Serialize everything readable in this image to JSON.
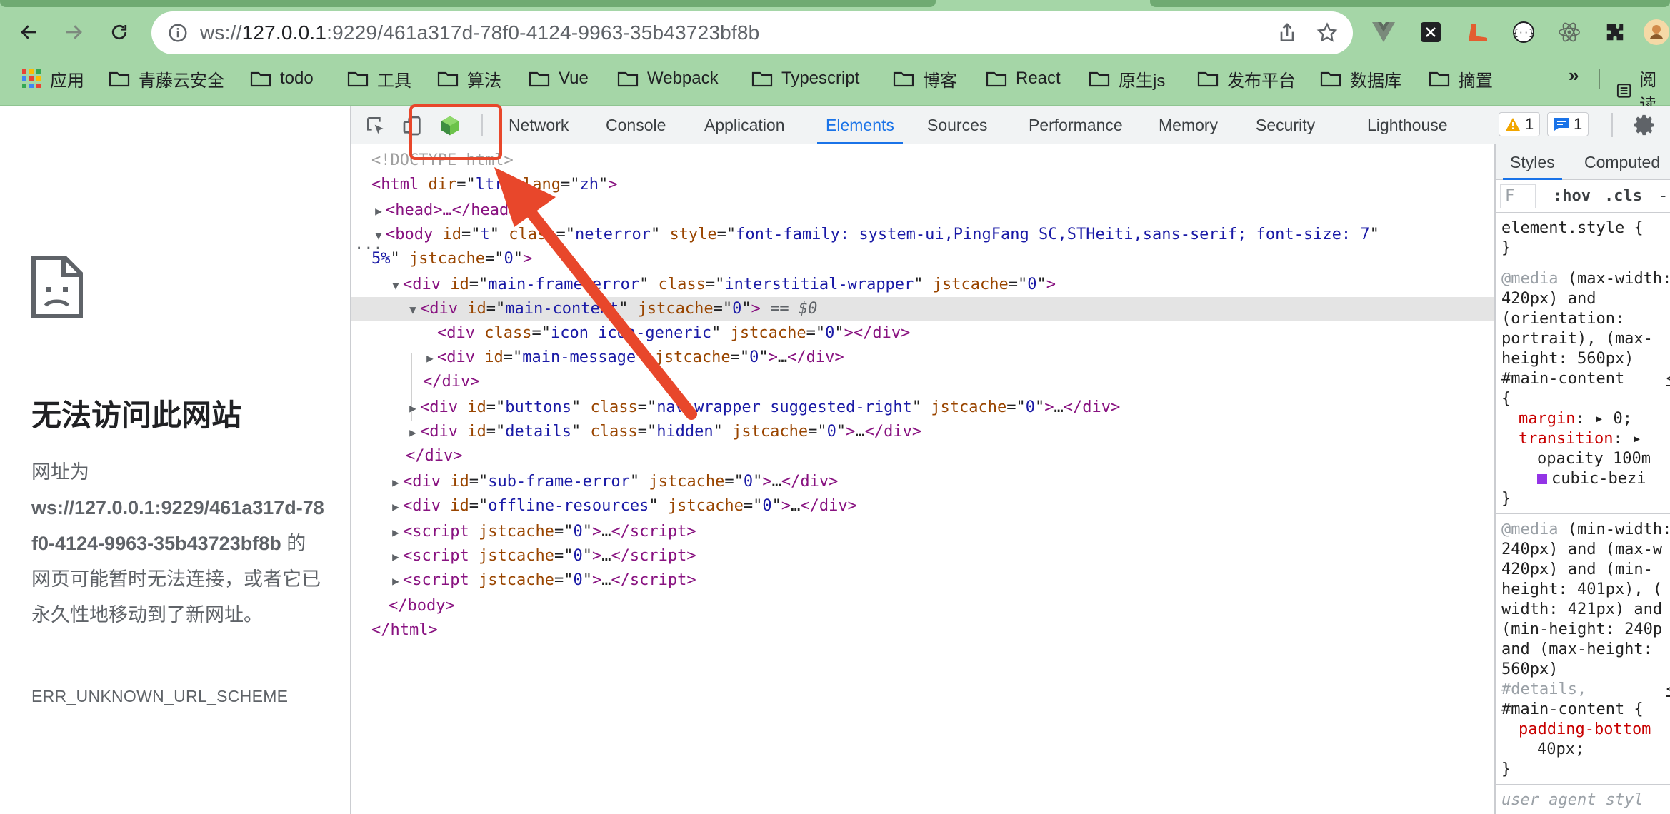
{
  "browser": {
    "url_scheme_host": "ws://",
    "url_host": "127.0.0.1",
    "url_rest": ":9229/461a317d-78f0-4124-9963-35b43723bf8b",
    "bookmarks": [
      {
        "label": "应用",
        "icon": "apps-grid-icon"
      },
      {
        "label": "青藤云安全"
      },
      {
        "label": "todo"
      },
      {
        "label": "工具"
      },
      {
        "label": "算法"
      },
      {
        "label": "Vue"
      },
      {
        "label": "Webpack"
      },
      {
        "label": "Typescript"
      },
      {
        "label": "博客"
      },
      {
        "label": "React"
      },
      {
        "label": "原生js"
      },
      {
        "label": "发布平台"
      },
      {
        "label": "数据库"
      },
      {
        "label": "摘置"
      }
    ],
    "bookmarks_more": "»",
    "reading_list": "阅读"
  },
  "error_page": {
    "title": "无法访问此网站",
    "body_prefix": "网址为",
    "body_url": "ws://127.0.0.1:9229/461a317d-78f0-4124-9963-35b43723bf8b",
    "body_suffix": " 的网页可能暂时无法连接，或者它已永久性地移动到了新网址。",
    "error_code": "ERR_UNKNOWN_URL_SCHEME"
  },
  "devtools": {
    "tabs": [
      "Network",
      "Console",
      "Application",
      "Elements",
      "Sources",
      "Performance",
      "Memory",
      "Security",
      "Lighthouse"
    ],
    "active_tab": "Elements",
    "warnings_count": "1",
    "messages_count": "1",
    "styles_tabs": [
      "Styles",
      "Computed"
    ],
    "filter_placeholder": "F",
    "hov": ":hov",
    "cls": ".cls",
    "plus": "-",
    "selected_marker": "== $0",
    "ellipsis": "···"
  },
  "dom": {
    "doctype": "<!DOCTYPE html>",
    "html_open": {
      "tag": "html",
      "attrs": [
        [
          "dir",
          "ltr"
        ],
        [
          "lang",
          "zh"
        ]
      ]
    },
    "head": "<head>…</head>",
    "body_attrs": [
      [
        "id",
        "t"
      ],
      [
        "class",
        "neterror"
      ],
      [
        "style",
        "font-family: system-ui,PingFang SC,STHeiti,sans-serif; font-size: 7"
      ]
    ],
    "body_wrap": "5%\" jstcache=\"0\">",
    "main_frame": [
      [
        "id",
        "main-frame-error"
      ],
      [
        "class",
        "interstitial-wrapper"
      ],
      [
        "jstcache",
        "0"
      ]
    ],
    "main_content": [
      [
        "id",
        "main-content"
      ],
      [
        "jstcache",
        "0"
      ]
    ],
    "icon_div": [
      [
        "class",
        "icon icon-generic"
      ],
      [
        "jstcache",
        "0"
      ]
    ],
    "main_message": [
      [
        "id",
        "main-message"
      ],
      [
        "jstcache",
        "0"
      ]
    ],
    "buttons_div": [
      [
        "id",
        "buttons"
      ],
      [
        "class",
        "nav-wrapper suggested-right"
      ],
      [
        "jstcache",
        "0"
      ]
    ],
    "details_div": [
      [
        "id",
        "details"
      ],
      [
        "class",
        "hidden"
      ],
      [
        "jstcache",
        "0"
      ]
    ],
    "sub_frame": [
      [
        "id",
        "sub-frame-error"
      ],
      [
        "jstcache",
        "0"
      ]
    ],
    "offline": [
      [
        "id",
        "offline-resources"
      ],
      [
        "jstcache",
        "0"
      ]
    ],
    "script_attr": [
      [
        "jstcache",
        "0"
      ]
    ]
  },
  "styles": {
    "element_style": "element.style {",
    "close": "}",
    "media1": [
      "@media (max-width:",
      "420px) and",
      "(orientation:",
      "portrait), (max-",
      "height: 560px)",
      "#main-content",
      "{"
    ],
    "media1_props": [
      [
        "margin",
        "0;"
      ],
      [
        "transition",
        ""
      ]
    ],
    "media1_cont": [
      "opacity 100m",
      "cubic-bezi"
    ],
    "media2": [
      "@media (min-width:",
      "240px) and (max-w",
      "420px) and (min-",
      "height: 401px), (",
      "width: 421px) and",
      "(min-height: 240p",
      "and (max-height:",
      "560px)"
    ],
    "media2_sel": [
      "#details,",
      "#main-content {"
    ],
    "media2_prop": [
      "padding-bottom",
      "40px;"
    ],
    "user_agent": "user agent styl",
    "link_char": "<"
  },
  "colors": {
    "chrome_green": "#a5d6a7",
    "accent_blue": "#1a73e8",
    "annotation_red": "#e8472b"
  }
}
